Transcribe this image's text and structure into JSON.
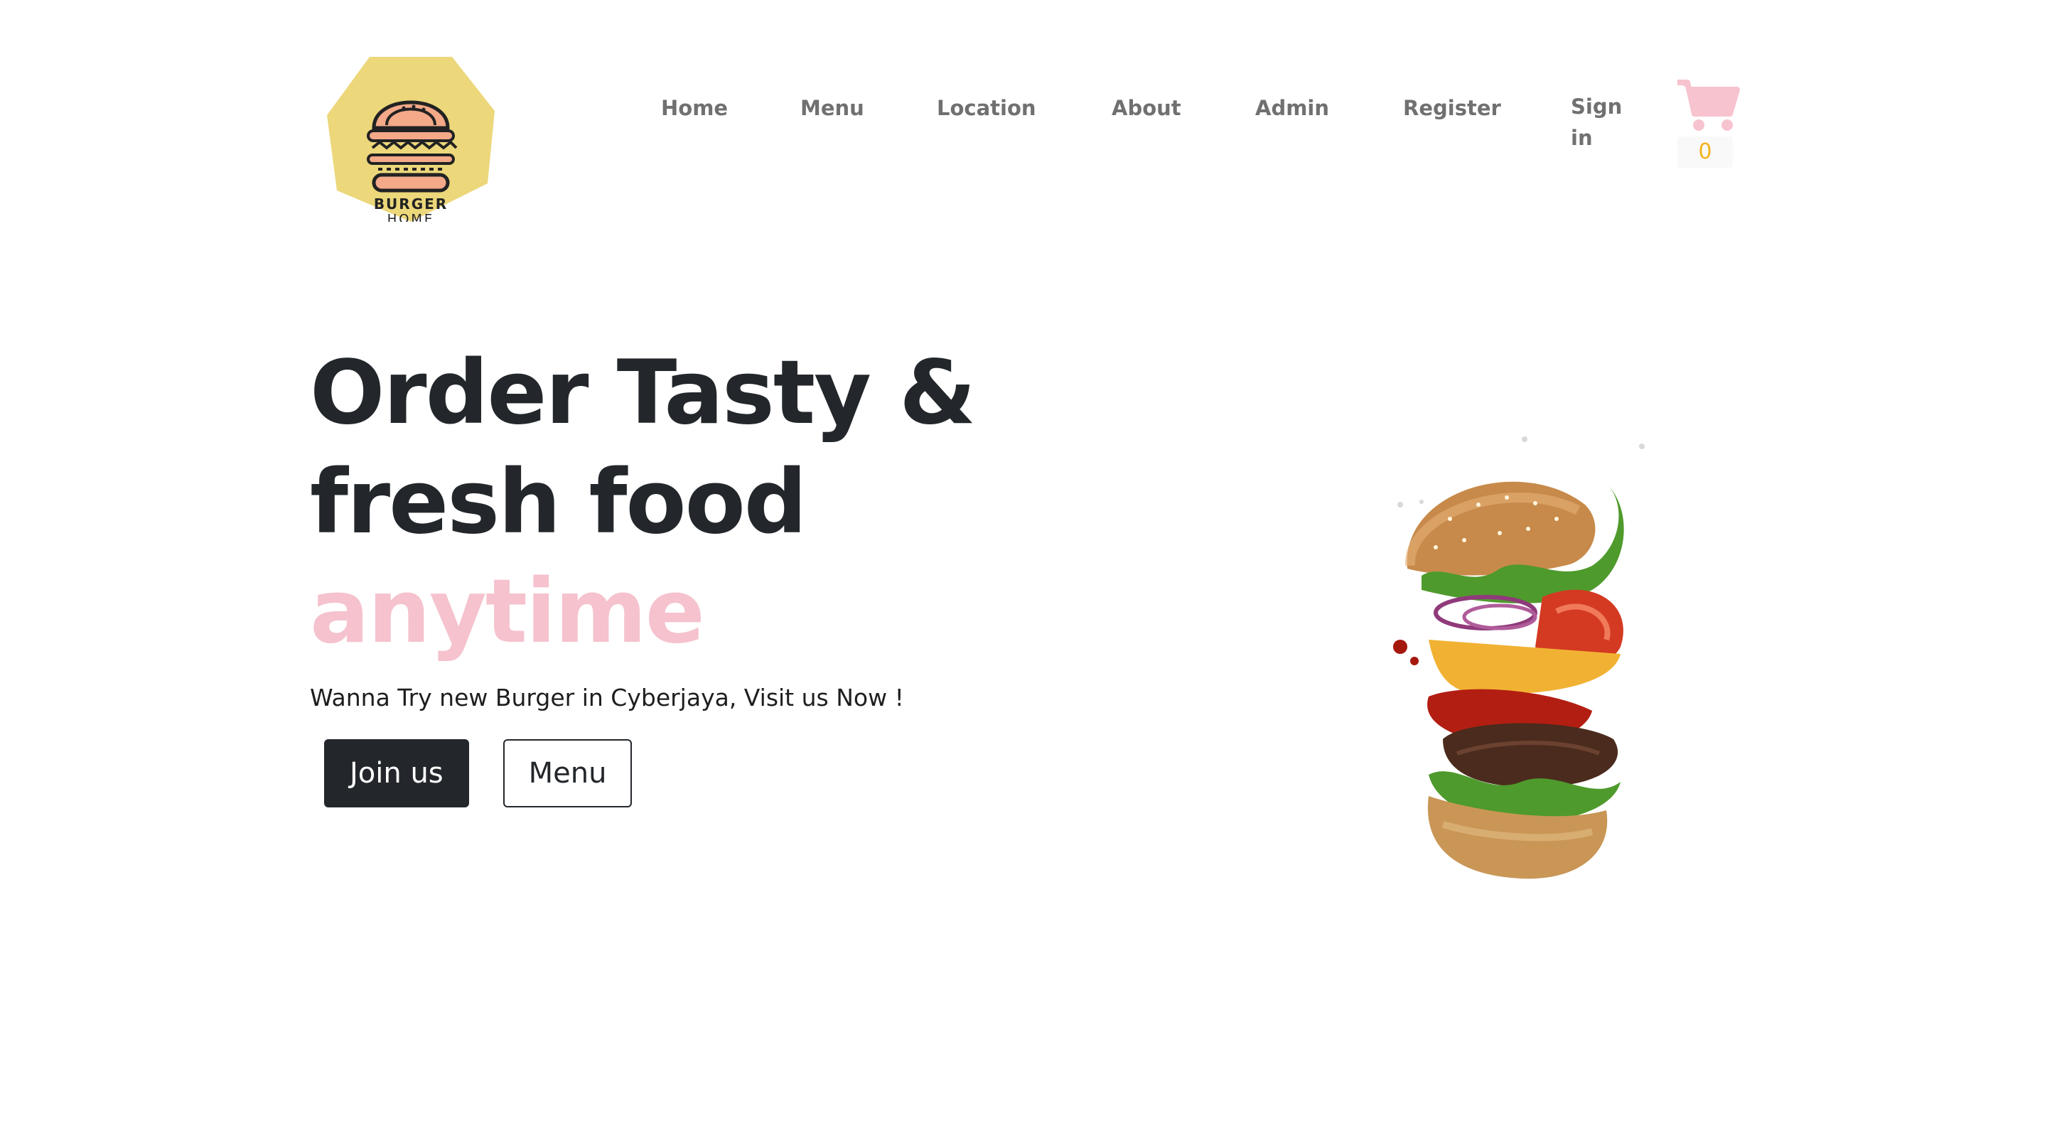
{
  "brand": {
    "logo_line1": "BURGER",
    "logo_line2": "HOME",
    "logo_color": "#ecd77a"
  },
  "nav": {
    "links": [
      {
        "label": "Home"
      },
      {
        "label": "Menu"
      },
      {
        "label": "Location"
      },
      {
        "label": "About"
      },
      {
        "label": "Admin"
      },
      {
        "label": "Register"
      },
      {
        "label": "Sign in"
      }
    ],
    "link_color": "#707070"
  },
  "cart": {
    "icon": "shopping-cart-icon",
    "count": "0",
    "icon_color": "#f7c3cf",
    "count_color": "#f5b21e"
  },
  "hero": {
    "headline_line1": "Order Tasty &",
    "headline_line2": "fresh food",
    "headline_accent": "anytime",
    "subtitle": "Wanna Try new Burger in Cyberjaya, Visit us Now !",
    "primary_button": "Join us",
    "secondary_button": "Menu",
    "headline_color": "#23272b",
    "accent_color": "#f5c2cd"
  }
}
